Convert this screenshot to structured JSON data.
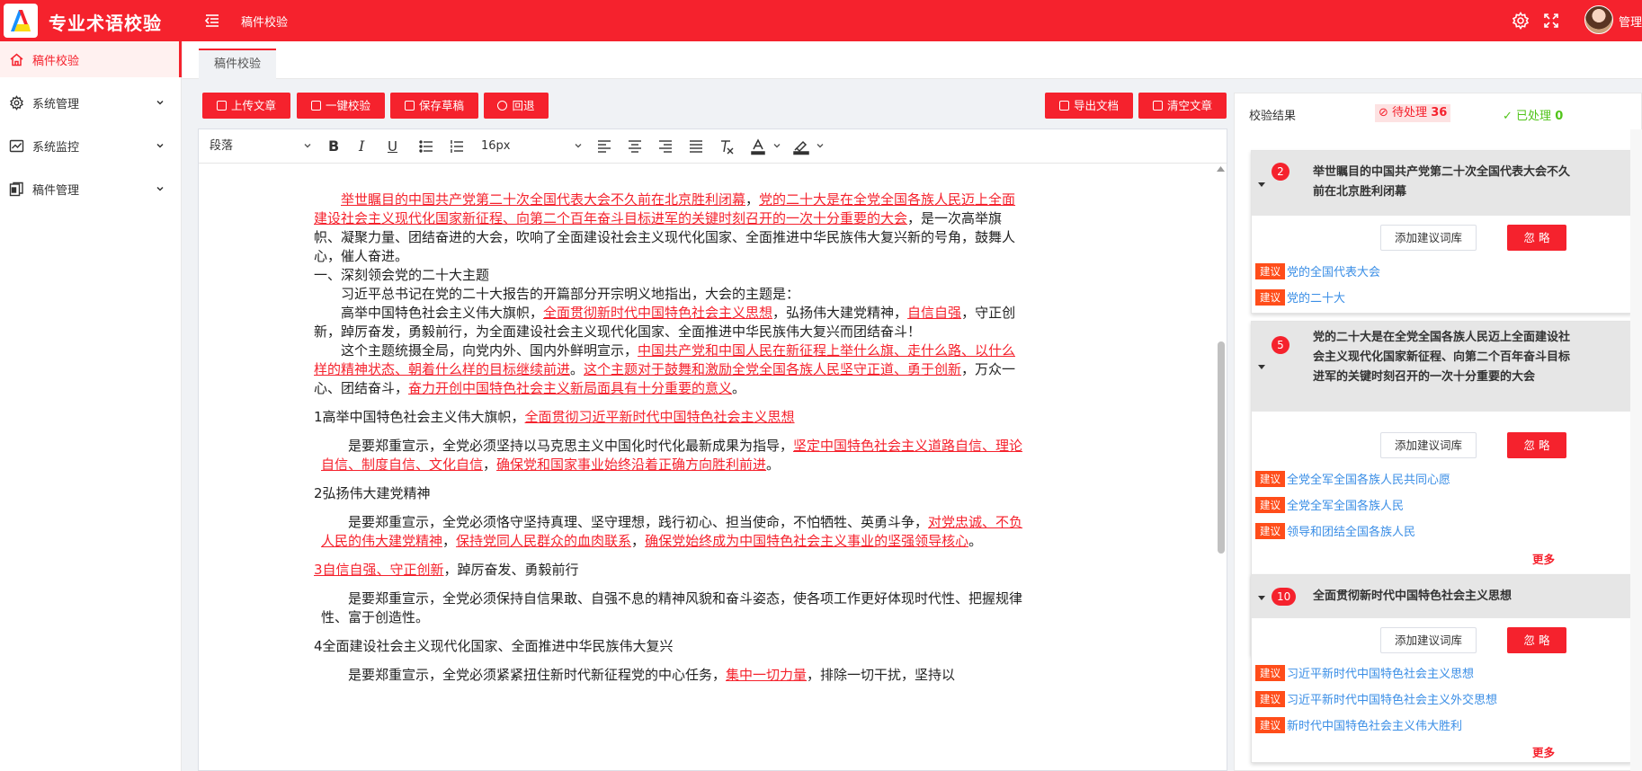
{
  "header": {
    "app_title": "专业术语校验",
    "breadcrumb": "稿件校验",
    "user_label": "管理",
    "colors": {
      "brand": "#f5222d"
    },
    "icons": [
      "logo-icon",
      "menu-fold-icon",
      "settings-icon",
      "fullscreen-icon"
    ]
  },
  "sidebar": {
    "items": [
      {
        "label": "稿件校验",
        "icon": "home-icon",
        "active": true
      },
      {
        "label": "系统管理",
        "icon": "gear-icon",
        "expandable": true
      },
      {
        "label": "系统监控",
        "icon": "chart-icon",
        "expandable": true
      },
      {
        "label": "稿件管理",
        "icon": "document-icon",
        "expandable": true
      }
    ]
  },
  "tabs": [
    {
      "label": "稿件校验",
      "active": true
    }
  ],
  "actions": {
    "upload": "上传文章",
    "check": "一键校验",
    "save_draft": "保存草稿",
    "undo": "回退",
    "export": "导出文档",
    "clear": "清空文章"
  },
  "toolbar": {
    "paragraph": "段落",
    "font_size": "16px"
  },
  "article": {
    "p1_a": "举世瞩目的中国共产党第二十次全国代表大会不久前在北京胜利闭幕",
    "p1_b": "，",
    "p1_c": "党的二十大是在全党全国各族人民迈上全面建设社会主义现代化国家新征程、向第二个百年奋斗目标进军的关键时刻召开的一次十分重要的大会",
    "p1_d": "，是一次高举旗帜、凝聚力量、团结奋进的大会，吹响了全面建设社会主义现代化国家、全面推进中华民族伟大复兴新的号角，鼓舞人心，催人奋进。",
    "h1": "一、深刻领会党的二十大主题",
    "p2": "习近平总书记在党的二十大报告的开篇部分开宗明义地指出，大会的主题是：",
    "p3_a": "高举中国特色社会主义伟大旗帜，",
    "p3_b": "全面贯彻新时代中国特色社会主义思想",
    "p3_c": "，弘扬伟大建党精神，",
    "p3_d": "自信自强",
    "p3_e": "，守正创新，踔厉奋发，勇毅前行，为全面建设社会主义现代化国家、全面推进中华民族伟大复兴而团结奋斗！",
    "p4_a": "这个主题统摄全局，向党内外、国内外鲜明宣示，",
    "p4_b": "中国共产党和中国人民在新征程上举什么旗、走什么路、以什么样的精神状态、朝着什么样的目标继续前进",
    "p4_c": "。",
    "p4_d": "这个主题对于鼓舞和激励全党全国各族人民坚守正道、勇于创新",
    "p4_e": "，万众一心、团结奋斗，",
    "p4_f": "奋力开创中国特色社会主义新局面具有十分重要的意义",
    "p4_g": "。",
    "s1_a": "1高举中国特色社会主义伟大旗帜，",
    "s1_b": "全面贯彻习近平新时代中国特色社会主义思想",
    "s1p_a": "是要郑重宣示，全党必须坚持以马克思主义中国化时代化最新成果为指导，",
    "s1p_b": "坚定中国特色社会主义道路自信、理论自信、制度自信、文化自信",
    "s1p_c": "，",
    "s1p_d": "确保党和国家事业始终沿着正确方向胜利前进",
    "s1p_e": "。",
    "s2": "2弘扬伟大建党精神",
    "s2p_a": "是要郑重宣示，全党必须恪守坚持真理、坚守理想，践行初心、担当使命，不怕牺牲、英勇斗争，",
    "s2p_b": "对党忠诚、不负人民的伟大建党精神",
    "s2p_c": "，",
    "s2p_d": "保持党同人民群众的血肉联系",
    "s2p_e": "，",
    "s2p_f": "确保党始终成为中国特色社会主义事业的坚强领导核心",
    "s2p_g": "。",
    "s3_a": "3自信自强、守正创新",
    "s3_b": "，踔厉奋发、勇毅前行",
    "s3p": "是要郑重宣示，全党必须保持自信果敢、自强不息的精神风貌和奋斗姿态，使各项工作更好体现时代性、把握规律性、富于创造性。",
    "s4": "4全面建设社会主义现代化国家、全面推进中华民族伟大复兴",
    "s4p_a": "是要郑重宣示，全党必须紧紧扭住新时代新征程党的中心任务，",
    "s4p_b": "集中一切力量",
    "s4p_c": "，排除一切干扰，坚持以"
  },
  "results": {
    "title": "校验结果",
    "pending_label": "待处理",
    "pending_count": "36",
    "done_label": "已处理",
    "done_count": "0",
    "add_label": "添加建议词库",
    "ignore_label": "忽 略",
    "suggest_tag": "建议",
    "more_label": "更多",
    "cards": [
      {
        "count": "2",
        "title": "举世瞩目的中国共产党第二十次全国代表大会不久前在北京胜利闭幕",
        "suggestions": [
          "党的全国代表大会",
          "党的二十大"
        ]
      },
      {
        "count": "5",
        "title": "党的二十大是在全党全国各族人民迈上全面建设社会主义现代化国家新征程、向第二个百年奋斗目标进军的关键时刻召开的一次十分重要的大会",
        "suggestions": [
          "全党全军全国各族人民共同心愿",
          "全党全军全国各族人民",
          "领导和团结全国各族人民"
        ]
      },
      {
        "count": "10",
        "title": "全面贯彻新时代中国特色社会主义思想",
        "suggestions": [
          "习近平新时代中国特色社会主义思想",
          "习近平新时代中国特色社会主义外交思想",
          "新时代中国特色社会主义伟大胜利"
        ]
      }
    ]
  }
}
